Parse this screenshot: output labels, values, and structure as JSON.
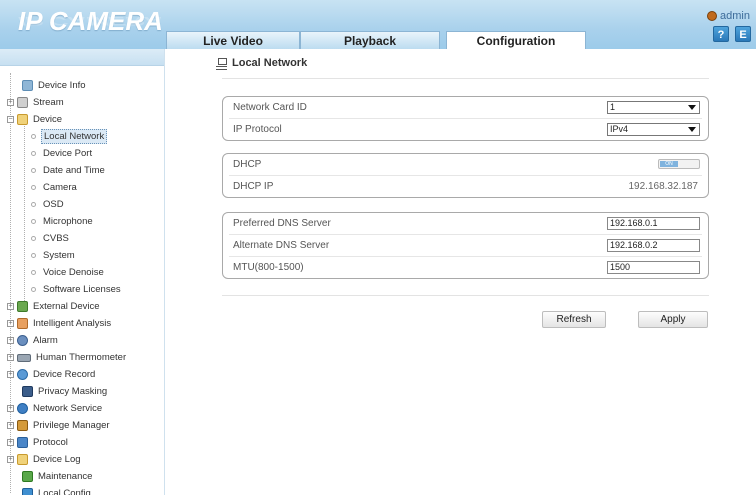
{
  "header": {
    "logo": "IP CAMERA",
    "user": "admin",
    "help_label": "?",
    "logout_label": "E"
  },
  "tabs": [
    {
      "label": "Live Video"
    },
    {
      "label": "Playback"
    },
    {
      "label": "Configuration",
      "active": true
    }
  ],
  "sidebar": {
    "items": [
      {
        "label": "Device Info",
        "icon": "info-icon"
      },
      {
        "label": "Stream",
        "icon": "stream-icon"
      },
      {
        "label": "Device",
        "icon": "folder-icon"
      },
      {
        "label": "Local Network",
        "selected": true
      },
      {
        "label": "Device Port"
      },
      {
        "label": "Date and Time"
      },
      {
        "label": "Camera"
      },
      {
        "label": "OSD"
      },
      {
        "label": "Microphone"
      },
      {
        "label": "CVBS"
      },
      {
        "label": "System"
      },
      {
        "label": "Voice Denoise"
      },
      {
        "label": "Software Licenses"
      },
      {
        "label": "External Device",
        "icon": "external-device-icon"
      },
      {
        "label": "Intelligent Analysis",
        "icon": "analysis-icon"
      },
      {
        "label": "Alarm",
        "icon": "alarm-icon"
      },
      {
        "label": "Human Thermometer",
        "icon": "thermometer-icon"
      },
      {
        "label": "Device Record",
        "icon": "record-icon"
      },
      {
        "label": "Privacy Masking",
        "icon": "privacy-mask-icon"
      },
      {
        "label": "Network Service",
        "icon": "network-service-icon"
      },
      {
        "label": "Privilege Manager",
        "icon": "users-icon"
      },
      {
        "label": "Protocol",
        "icon": "protocol-icon"
      },
      {
        "label": "Device Log",
        "icon": "log-icon"
      },
      {
        "label": "Maintenance",
        "icon": "maintenance-icon"
      },
      {
        "label": "Local Config",
        "icon": "local-config-icon"
      }
    ]
  },
  "page": {
    "title": "Local Network",
    "network_card_label": "Network Card ID",
    "network_card_value": "1",
    "ip_protocol_label": "IP Protocol",
    "ip_protocol_value": "IPv4",
    "dhcp_label": "DHCP",
    "dhcp_toggle_text": "ON",
    "dhcp_ip_label": "DHCP IP",
    "dhcp_ip_value": "192.168.32.187",
    "pref_dns_label": "Preferred DNS Server",
    "pref_dns_value": "192.168.0.1",
    "alt_dns_label": "Alternate DNS Server",
    "alt_dns_value": "192.168.0.2",
    "mtu_label": "MTU(800-1500)",
    "mtu_value": "1500",
    "refresh_label": "Refresh",
    "apply_label": "Apply"
  },
  "colors": {
    "header_bg": "#a9d1ec",
    "accent": "#2a78b8",
    "selected_bg": "#dbe9f5"
  }
}
